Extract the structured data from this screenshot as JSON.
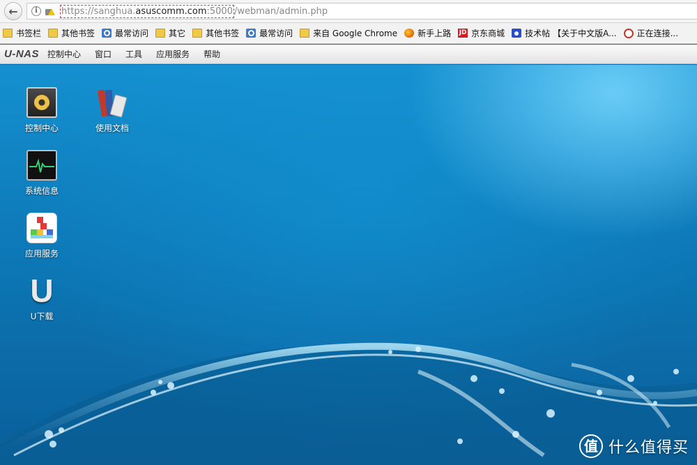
{
  "browser": {
    "url_prefix": "https://",
    "url_host_sub": "sanghua.",
    "url_host_main": "asuscomm.com",
    "url_port": ":5000",
    "url_path": "/webman/admin.php"
  },
  "bookmarks": [
    {
      "icon": "folder-icon",
      "label": "书签栏"
    },
    {
      "icon": "folder-icon",
      "label": "其他书签"
    },
    {
      "icon": "magnify-icon",
      "label": "最常访问"
    },
    {
      "icon": "folder-icon",
      "label": "其它"
    },
    {
      "icon": "folder-icon",
      "label": "其他书签"
    },
    {
      "icon": "magnify-icon",
      "label": "最常访问"
    },
    {
      "icon": "folder-icon",
      "label": "来自 Google Chrome"
    },
    {
      "icon": "firefox-icon",
      "label": "新手上路"
    },
    {
      "icon": "jd-icon",
      "label": "京东商城"
    },
    {
      "icon": "paw-icon",
      "label": "技术帖"
    },
    {
      "icon": "blank-icon",
      "label": "【关于中文版A..."
    },
    {
      "icon": "ring-icon",
      "label": "正在连接..."
    }
  ],
  "jd_icon_text": "JD",
  "appbar": {
    "brand": "U-NAS",
    "menu": [
      "控制中心",
      "窗口",
      "工具",
      "应用服务",
      "帮助"
    ]
  },
  "desktop": {
    "icons": [
      {
        "name": "control-center",
        "label": "控制中心"
      },
      {
        "name": "docs",
        "label": "使用文档"
      },
      {
        "name": "system-info",
        "label": "系统信息"
      },
      {
        "name": "app-services",
        "label": "应用服务"
      },
      {
        "name": "u-download",
        "label": "U下载"
      }
    ],
    "u_download_glyph": "U"
  },
  "watermark": {
    "glyph": "值",
    "text": "什么值得买"
  },
  "colors": {
    "desktop_top": "#1590cf",
    "desktop_bottom": "#0a5e98",
    "url_highlight_border": "#d33"
  }
}
